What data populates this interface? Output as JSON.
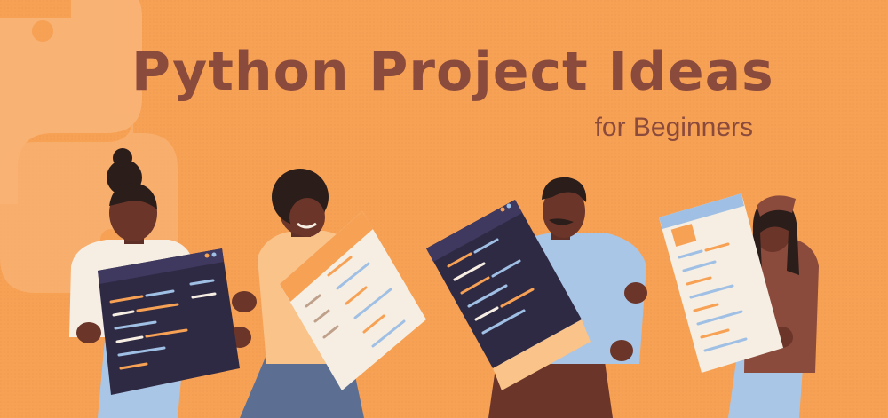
{
  "banner": {
    "title": "Python Project Ideas",
    "subtitle": "for Beginners",
    "colors": {
      "background": "#f7a155",
      "title": "#8a4a3c",
      "logo_watermark": "#f9b478",
      "screen_dark": "#2f2a44",
      "screen_light": "#f6eee3"
    },
    "illustration": {
      "watermark": "python-logo",
      "people": [
        {
          "name": "woman-with-bun",
          "device": "dark-code-window"
        },
        {
          "name": "man-afro",
          "device": "light-tablet"
        },
        {
          "name": "man-mustache",
          "device": "dark-laptop-screen"
        },
        {
          "name": "woman-long-hair",
          "device": "light-phone"
        }
      ]
    }
  }
}
